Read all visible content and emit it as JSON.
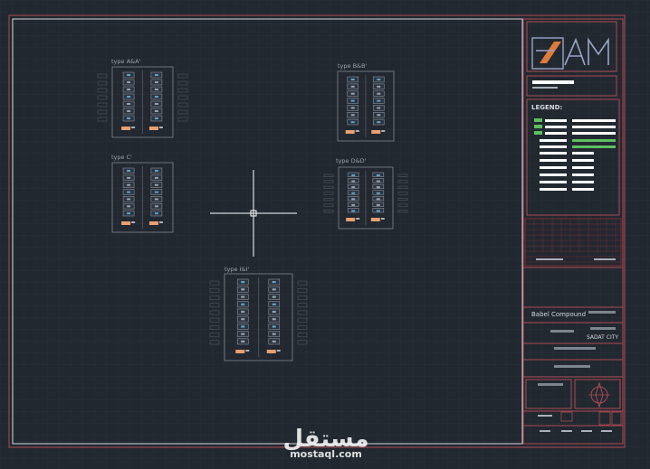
{
  "drawing": {
    "type_labels": [
      "type A&A'",
      "type B&B'",
      "type C'",
      "type D&D'",
      "type I&I'"
    ]
  },
  "title_block": {
    "legend_title": "LEGEND:",
    "project_name": "Babel Compound",
    "city": "SADAT CITY"
  },
  "watermark": {
    "brand": "مستقل",
    "url": "mostaql.com"
  },
  "colors": {
    "background": "#212830",
    "frame": "#b04a52",
    "orange_tag": "#e8a070",
    "cursor": "#ffffff"
  }
}
